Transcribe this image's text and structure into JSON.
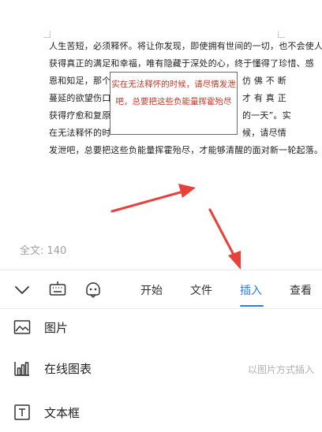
{
  "document": {
    "lines": [
      "人生苦短，必须释怀。将让你发现，即使拥有世间的一切，也不会使人",
      "获得真正的满足和幸福，唯有隐藏于深处的心，终于懂得了珍惜、感",
      "恩和知足，那个",
      "蔓延的欲望伤口，",
      "获得疗愈和复原",
      "在无法释怀的时",
      "发泄吧，总要把这些负能量挥霍殆尽，才能够清醒的面对新一轮起落。"
    ],
    "lines_right": [
      "仿 佛 不 断",
      "才 有 真 正",
      "的一天”。实",
      "候，请尽情"
    ],
    "textbox_lines": [
      "实在无法释怀的时候，请尽情发泄",
      "吧，总要把这些负能量挥霍殆尽"
    ],
    "word_count": "全文: 140"
  },
  "toolbar": {
    "tabs": [
      "开始",
      "文件",
      "插入",
      "查看"
    ],
    "active_tab": "插入"
  },
  "menu": {
    "items": [
      {
        "label": "图片",
        "icon": "image-icon"
      },
      {
        "label": "在线图表",
        "icon": "bar-chart-icon",
        "hint": "以图片方式插入"
      },
      {
        "label": "文本框",
        "icon": "textbox-icon"
      }
    ]
  },
  "colors": {
    "accent": "#2f7bea",
    "textbox_text": "#c0392b",
    "arrow": "#e8403a"
  }
}
